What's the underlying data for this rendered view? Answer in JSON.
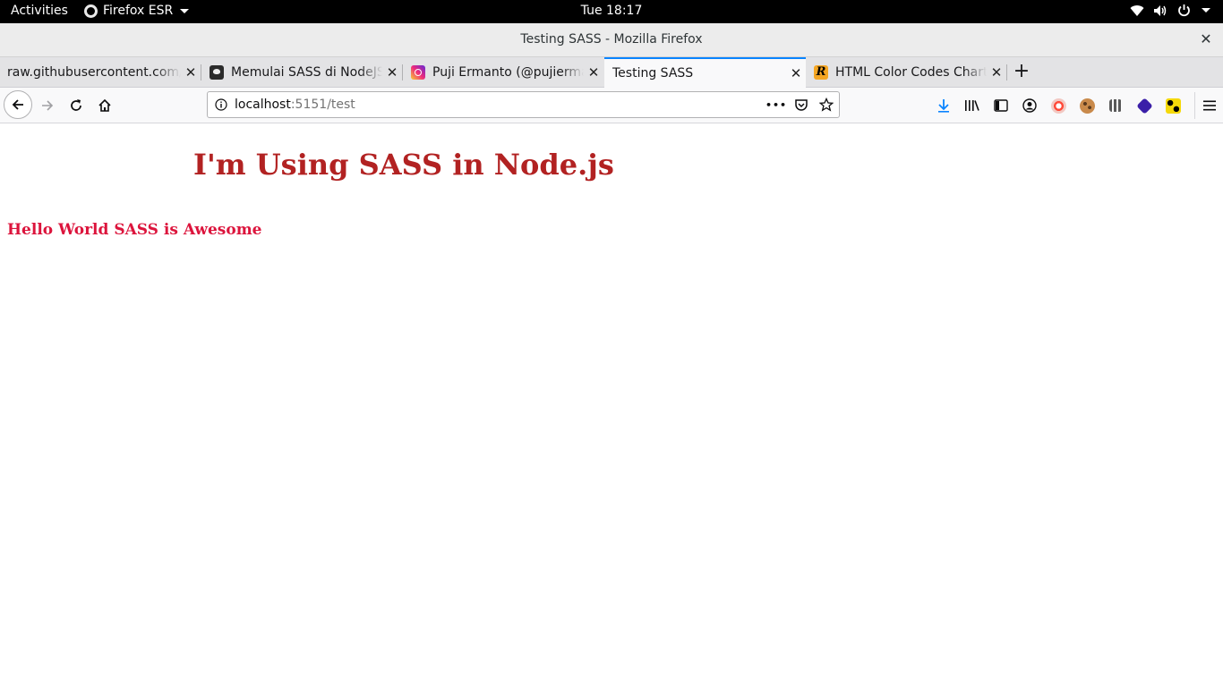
{
  "system_bar": {
    "activities": "Activities",
    "app_name": "Firefox ESR",
    "clock": "Tue 18:17",
    "tray_icons": [
      "wifi-icon",
      "volume-icon",
      "power-icon",
      "chevron-down-icon"
    ]
  },
  "window": {
    "title": "Testing SASS - Mozilla Firefox",
    "close_glyph": "✕"
  },
  "tabs": [
    {
      "label": "raw.githubusercontent.com/c",
      "icon": "none",
      "active": false
    },
    {
      "label": "Memulai SASS di NodeJS",
      "icon": "avatar-favicon",
      "active": false
    },
    {
      "label": "Puji Ermanto (@pujierman",
      "icon": "instagram-favicon",
      "active": false
    },
    {
      "label": "Testing SASS",
      "icon": "none",
      "active": true
    },
    {
      "label": "HTML Color Codes Chart",
      "icon": "r-favicon",
      "active": false
    }
  ],
  "tab_close_glyph": "✕",
  "new_tab_glyph": "+",
  "nav": {
    "url_host": "localhost",
    "url_rest": ":5151/test",
    "page_actions_glyph": "•••"
  },
  "page": {
    "heading": "I'm Using SASS in Node.js",
    "paragraph": "Hello World SASS is Awesome",
    "heading_color": "#b22222",
    "paragraph_color": "#dc143c"
  },
  "colors": {
    "accent": "#0a84ff",
    "download": "#0a84ff"
  }
}
